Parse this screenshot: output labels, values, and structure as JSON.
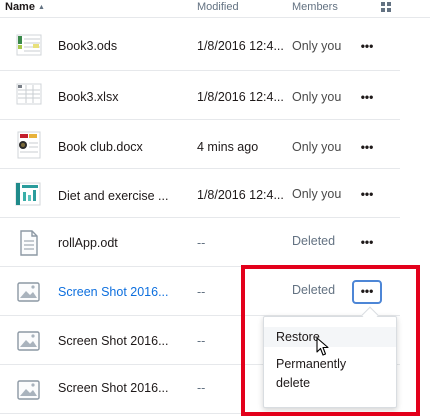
{
  "header": {
    "name_label": "Name",
    "sort_indicator": "▲",
    "modified_label": "Modified",
    "members_label": "Members",
    "view_toggle_icon": "grid-icon"
  },
  "rows": [
    {
      "name": "Book3.ods",
      "modified": "1/8/2016 12:4...",
      "members": "Only you",
      "thumb": "spreadsheet-thumbnail",
      "link": false,
      "deleted": false
    },
    {
      "name": "Book3.xlsx",
      "modified": "1/8/2016 12:4...",
      "members": "Only you",
      "thumb": "spreadsheet-thumbnail",
      "link": false,
      "deleted": false
    },
    {
      "name": "Book club.docx",
      "modified": "4 mins ago",
      "members": "Only you",
      "thumb": "document-thumbnail",
      "link": false,
      "deleted": false
    },
    {
      "name": "Diet and exercise ...",
      "modified": "1/8/2016 12:4...",
      "members": "Only you",
      "thumb": "chart-thumbnail",
      "link": false,
      "deleted": false
    },
    {
      "name": "rollApp.odt",
      "modified": "--",
      "members": "Deleted",
      "thumb": "file-icon",
      "link": false,
      "deleted": true
    },
    {
      "name": "Screen Shot 2016...",
      "modified": "--",
      "members": "Deleted",
      "thumb": "image-icon",
      "link": true,
      "deleted": true
    },
    {
      "name": "Screen Shot 2016...",
      "modified": "--",
      "members": "",
      "thumb": "image-icon",
      "link": false,
      "deleted": true
    },
    {
      "name": "Screen Shot 2016...",
      "modified": "--",
      "members": "",
      "thumb": "image-icon",
      "link": false,
      "deleted": true
    }
  ],
  "more_label": "•••",
  "context_menu": {
    "items": [
      "Restore",
      "Permanently delete"
    ],
    "permanently_line1": "Permanently",
    "permanently_line2": "delete"
  },
  "colors": {
    "link": "#0d6fde",
    "highlight_box": "#e3001b",
    "active_button_border": "#4d86d6"
  }
}
